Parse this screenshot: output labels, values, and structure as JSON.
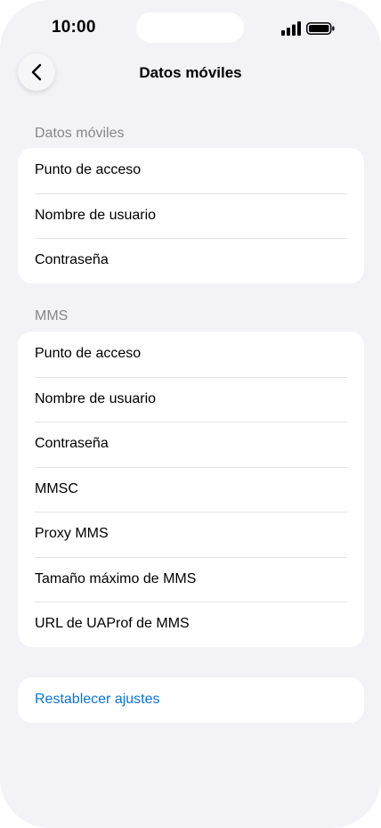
{
  "status_bar": {
    "time": "10:00",
    "signal_icon": "signal-icon",
    "battery_icon": "battery-icon"
  },
  "nav": {
    "back_icon": "chevron-left-icon",
    "title": "Datos móviles"
  },
  "sections": [
    {
      "header": "Datos móviles",
      "items": [
        {
          "label": "Punto de acceso"
        },
        {
          "label": "Nombre de usuario"
        },
        {
          "label": "Contraseña"
        }
      ]
    },
    {
      "header": "MMS",
      "items": [
        {
          "label": "Punto de acceso"
        },
        {
          "label": "Nombre de usuario"
        },
        {
          "label": "Contraseña"
        },
        {
          "label": "MMSC"
        },
        {
          "label": "Proxy MMS"
        },
        {
          "label": "Tamaño máximo de MMS"
        },
        {
          "label": "URL de UAProf de MMS"
        }
      ]
    }
  ],
  "reset": {
    "label": "Restablecer ajustes",
    "color": "#0a75d4"
  },
  "colors": {
    "background": "#f2f2f7",
    "card": "#ffffff",
    "section_header": "#86868b",
    "separator": "#e3e3e8"
  }
}
